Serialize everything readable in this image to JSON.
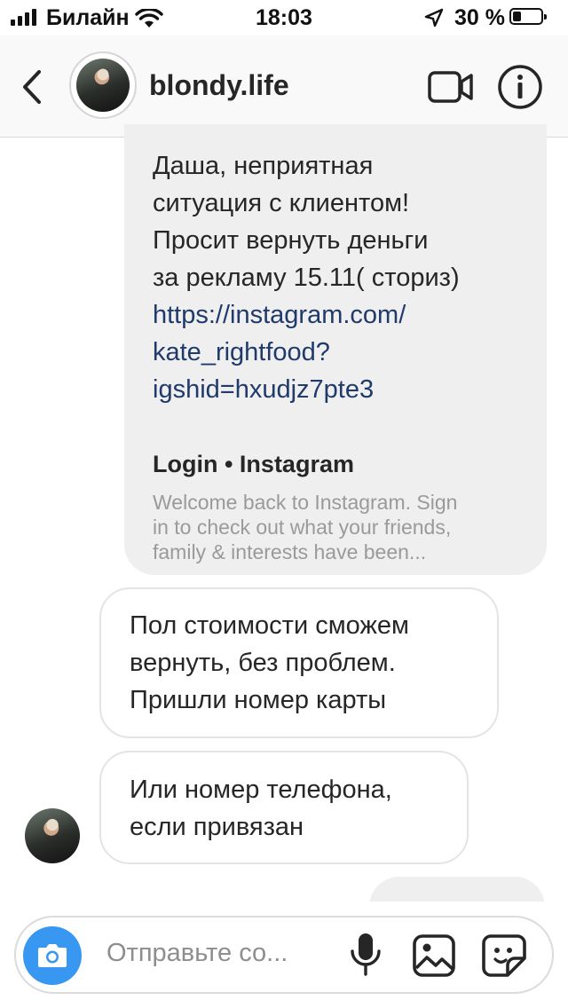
{
  "status_bar": {
    "carrier": "Билайн",
    "time": "18:03",
    "battery": "30 %"
  },
  "header": {
    "username": "blondy.life",
    "icons": [
      "back-chevron-icon",
      "video-call-icon",
      "info-icon"
    ]
  },
  "messages": [
    {
      "side": "right",
      "lines": [
        "Даша, неприятная",
        "ситуация с клиентом!",
        "Просит вернуть деньги",
        "за рекламу 15.11( сториз)"
      ],
      "link_lines": [
        "https://instagram.com/",
        "kate_rightfood?",
        "igshid=hxudjz7pte3"
      ],
      "preview": {
        "title": "Login • Instagram",
        "desc_lines": [
          "Welcome back to Instagram. Sign",
          "in to check out what your friends,",
          "family & interests have been..."
        ]
      }
    },
    {
      "side": "left",
      "lines": [
        "Пол стоимости сможем",
        "вернуть, без проблем.",
        "Пришли номер карты"
      ]
    },
    {
      "side": "left",
      "lines": [
        "Или номер телефона,",
        "если привязан"
      ]
    }
  ],
  "composer": {
    "placeholder": "Отправьте со...",
    "icons": [
      "camera-icon",
      "microphone-icon",
      "gallery-icon",
      "sticker-icon"
    ]
  },
  "colors": {
    "accent": "#3897f0",
    "link": "#1f3a6b",
    "bubble_gray": "#efefef"
  }
}
